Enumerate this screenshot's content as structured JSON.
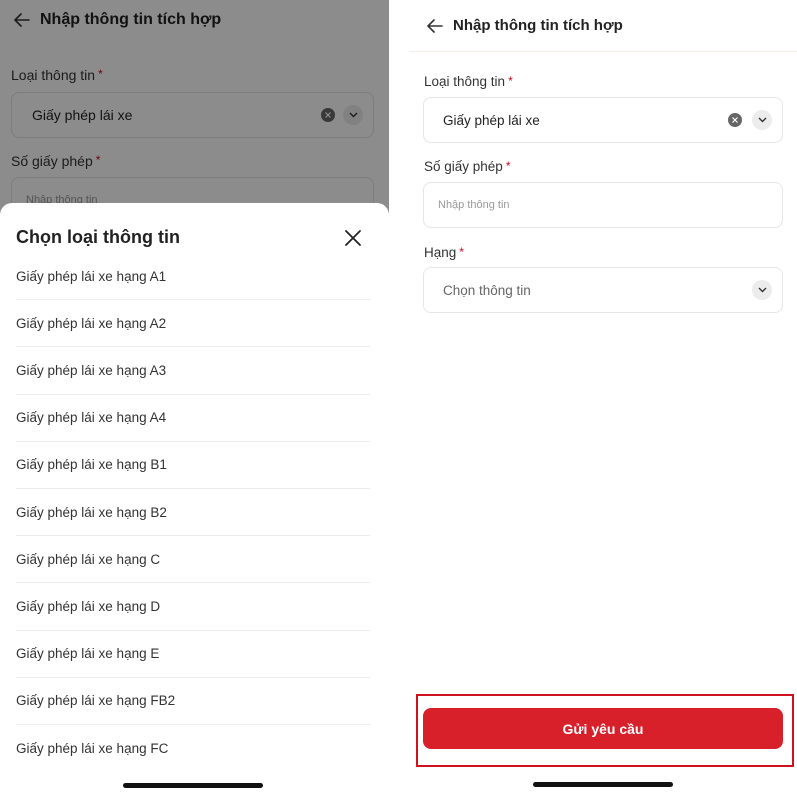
{
  "left": {
    "header_title": "Nhập thông tin tích hợp",
    "info_type_label": "Loại thông tin",
    "info_type_value": "Giấy phép lái xe",
    "license_no_label": "Số giấy phép",
    "license_no_placeholder": "Nhập thông tin",
    "required_mark": "*",
    "sheet": {
      "title": "Chọn loại thông tin",
      "items": [
        "Giấy phép lái xe hạng A1",
        "Giấy phép lái xe hạng A2",
        "Giấy phép lái xe hạng A3",
        "Giấy phép lái xe hạng A4",
        "Giấy phép lái xe hạng B1",
        "Giấy phép lái xe hạng B2",
        "Giấy phép lái xe hạng C",
        "Giấy phép lái xe hạng D",
        "Giấy phép lái xe hạng E",
        "Giấy phép lái xe hạng FB2",
        "Giấy phép lái xe hạng FC"
      ]
    }
  },
  "right": {
    "header_title": "Nhập thông tin tích hợp",
    "info_type_label": "Loại thông tin",
    "info_type_value": "Giấy phép lái xe",
    "license_no_label": "Số giấy phép",
    "license_no_placeholder": "Nhập thông tin",
    "class_label": "Hạng",
    "class_placeholder": "Chọn thông tin",
    "required_mark": "*",
    "submit_label": "Gửi yêu cầu"
  },
  "colors": {
    "accent": "#d8202a",
    "required": "#d0021b",
    "highlight_border": "#d0121f"
  },
  "icons": [
    "back-arrow-icon",
    "clear-icon",
    "chevron-down-icon",
    "close-icon"
  ]
}
